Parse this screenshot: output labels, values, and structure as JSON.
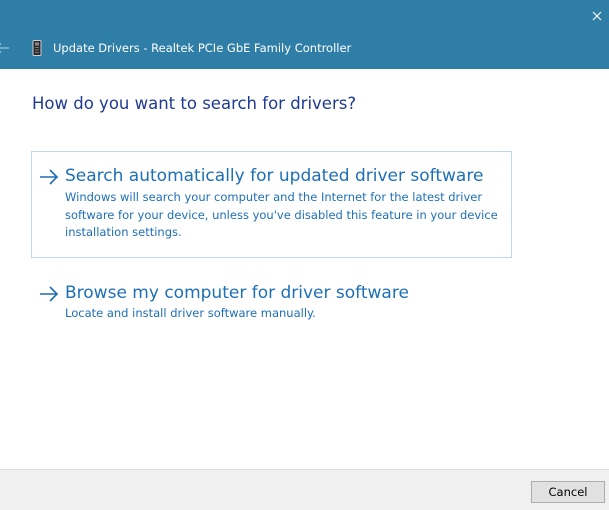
{
  "window": {
    "title": "Update Drivers - Realtek PCIe GbE Family Controller",
    "close_icon": "close-icon",
    "back_icon": "back-arrow-icon",
    "device_icon": "network-adapter-icon",
    "titlebar_color": "#2f7ea8"
  },
  "main": {
    "heading": "How do you want to search for drivers?",
    "options": [
      {
        "title": "Search automatically for updated driver software",
        "description": "Windows will search your computer and the Internet for the latest driver software for your device, unless you've disabled this feature in your device installation settings.",
        "icon": "arrow-right-icon"
      },
      {
        "title": "Browse my computer for driver software",
        "description": "Locate and install driver software manually.",
        "icon": "arrow-right-icon"
      }
    ],
    "link_color": "#1d6fb8",
    "heading_color": "#1f3a93"
  },
  "footer": {
    "cancel_label": "Cancel"
  }
}
